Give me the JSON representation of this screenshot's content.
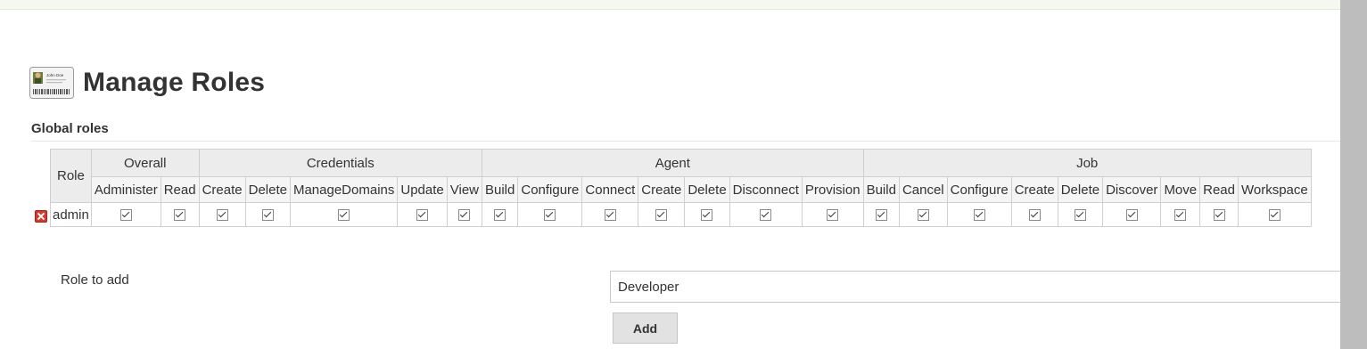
{
  "page": {
    "title": "Manage Roles",
    "icon": "id-card-icon"
  },
  "id_card": {
    "name": "John Doe"
  },
  "section": {
    "title": "Global roles"
  },
  "table": {
    "role_header": "Role",
    "groups": [
      {
        "name": "Overall",
        "permissions": [
          "Administer",
          "Read"
        ]
      },
      {
        "name": "Credentials",
        "permissions": [
          "Create",
          "Delete",
          "ManageDomains",
          "Update",
          "View"
        ]
      },
      {
        "name": "Agent",
        "permissions": [
          "Build",
          "Configure",
          "Connect",
          "Create",
          "Delete",
          "Disconnect",
          "Provision"
        ]
      },
      {
        "name": "Job",
        "permissions": [
          "Build",
          "Cancel",
          "Configure",
          "Create",
          "Delete",
          "Discover",
          "Move",
          "Read",
          "Workspace"
        ]
      }
    ],
    "rows": [
      {
        "role": "admin",
        "checked": [
          true,
          true,
          true,
          true,
          true,
          true,
          true,
          true,
          true,
          true,
          true,
          true,
          true,
          true,
          true,
          true,
          true,
          true,
          true,
          true,
          true,
          true,
          true
        ]
      }
    ]
  },
  "add_role": {
    "label": "Role to add",
    "value": "Developer",
    "button_label": "Add"
  },
  "colors": {
    "header_group_bg": "#ececec",
    "delete_red": "#d9362c"
  }
}
